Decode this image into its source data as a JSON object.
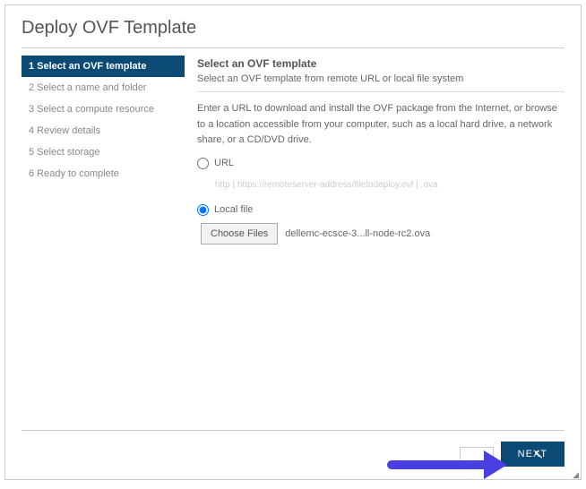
{
  "title": "Deploy OVF Template",
  "sidebar": {
    "steps": [
      {
        "label": "1 Select an OVF template"
      },
      {
        "label": "2 Select a name and folder"
      },
      {
        "label": "3 Select a compute resource"
      },
      {
        "label": "4 Review details"
      },
      {
        "label": "5 Select storage"
      },
      {
        "label": "6 Ready to complete"
      }
    ]
  },
  "main": {
    "heading": "Select an OVF template",
    "subtitle": "Select an OVF template from remote URL or local file system",
    "instructions": "Enter a URL to download and install the OVF package from the Internet, or browse to a location accessible from your computer, such as a local hard drive, a network share, or a CD/DVD drive.",
    "url_label": "URL",
    "url_placeholder": "http | https://remoteserver-address/filetodeploy.ovf | .ova",
    "localfile_label": "Local file",
    "choose_files_label": "Choose Files",
    "filename": "dellemc-ecsce-3...ll-node-rc2.ova"
  },
  "footer": {
    "cancel_label": "",
    "next_label": "NEXT"
  }
}
